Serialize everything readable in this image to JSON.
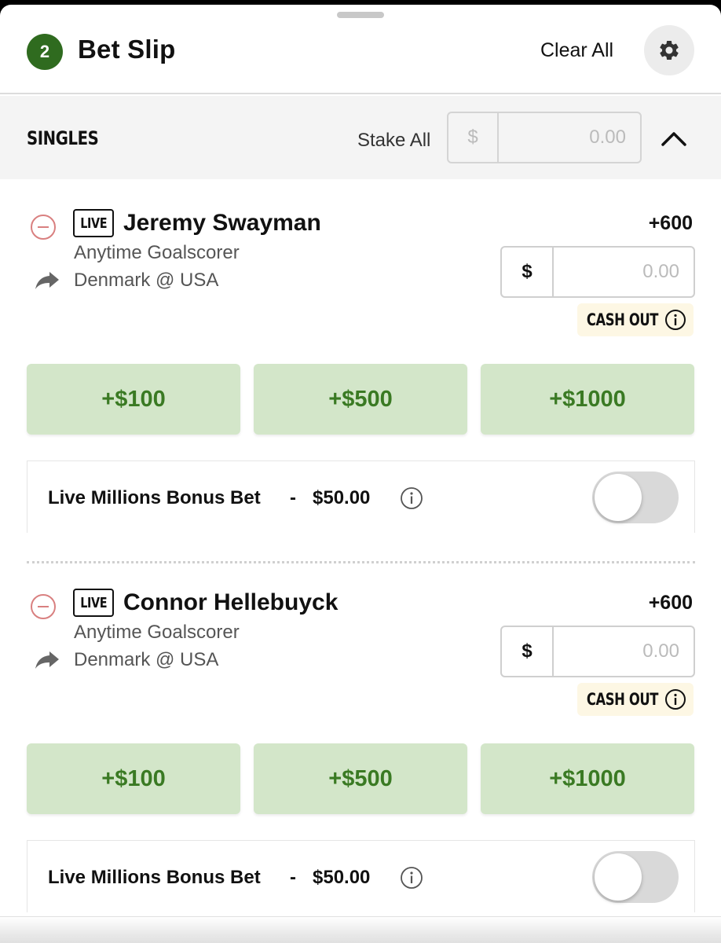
{
  "header": {
    "count": "2",
    "title": "Bet Slip",
    "clear_all": "Clear All"
  },
  "singles": {
    "label": "SINGLES",
    "stake_all_label": "Stake All",
    "currency": "$",
    "placeholder": "0.00"
  },
  "bets": [
    {
      "live": "LIVE",
      "player": "Jeremy Swayman",
      "market": "Anytime Goalscorer",
      "event": "Denmark @ USA",
      "odds": "+600",
      "currency": "$",
      "stake_placeholder": "0.00",
      "cash_out": "CASH OUT",
      "quick_stakes": [
        "+$100",
        "+$500",
        "+$1000"
      ],
      "bonus_label": "Live Millions Bonus Bet",
      "bonus_dash": "-",
      "bonus_amount": "$50.00",
      "bonus_enabled": false
    },
    {
      "live": "LIVE",
      "player": "Connor Hellebuyck",
      "market": "Anytime Goalscorer",
      "event": "Denmark @ USA",
      "odds": "+600",
      "currency": "$",
      "stake_placeholder": "0.00",
      "cash_out": "CASH OUT",
      "quick_stakes": [
        "+$100",
        "+$500",
        "+$1000"
      ],
      "bonus_label": "Live Millions Bonus Bet",
      "bonus_dash": "-",
      "bonus_amount": "$50.00",
      "bonus_enabled": false
    }
  ],
  "colors": {
    "brand_green": "#2f6b1f",
    "quick_bg": "#d3e6c9",
    "quick_text": "#3a7a23",
    "cashout_bg": "#fdf7e4",
    "remove_red": "#d98080"
  },
  "icons": {
    "settings": "gear-icon",
    "collapse": "chevron-up-icon",
    "remove": "minus-circle-icon",
    "share": "share-arrow-icon",
    "info": "info-icon"
  }
}
